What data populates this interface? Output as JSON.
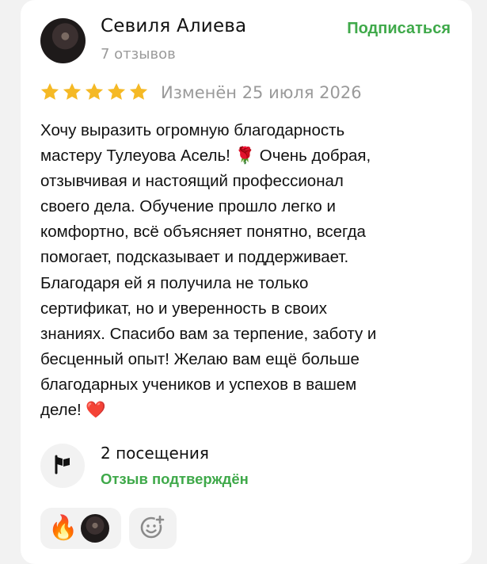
{
  "author": {
    "name": "Севиля Алиева",
    "reviews_count": "7 отзывов"
  },
  "subscribe_label": "Подписаться",
  "rating": {
    "stars": 5,
    "max": 5,
    "edited_label": "Изменён 25 июля 2026"
  },
  "review_text": "Хочу выразить огромную благодарность\nмастеру Тулеуова Асель! 🌹 Очень добрая,\nотзывчивая и настоящий профессионал\nсвоего дела. Обучение прошло легко и\nкомфортно, всё объясняет понятно, всегда\nпомогает, подсказывает и поддерживает.\nБлагодаря ей я получила не только\nсертификат, но и уверенность в своих\nзнаниях. Спасибо вам за терпение, заботу и\nбесценный опыт! Желаю вам ещё больше\nблагодарных учеников и успехов в вашем\nделе! ❤️",
  "visits": {
    "count_label": "2 посещения",
    "status_label": "Отзыв подтверждён",
    "icon": "flag-icon"
  },
  "reactions": {
    "emoji": "🔥",
    "reactor_icon": "avatar"
  },
  "colors": {
    "accent": "#3fa94a",
    "star": "#f5b925",
    "muted": "#9a9a9a"
  }
}
